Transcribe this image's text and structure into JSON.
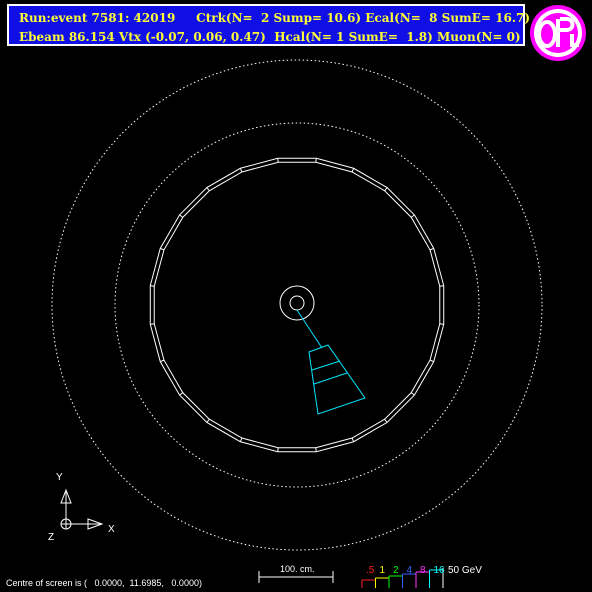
{
  "header": {
    "line1": "Run:event 7581: 42019     Ctrk(N=  2 Sump= 10.6) Ecal(N=  8 SumE= 16.7)",
    "line2": "Ebeam 86.154 Vtx (-0.07, 0.06, 0.47)  Hcal(N= 1 SumE=  1.8) Muon(N= 0)"
  },
  "logo": {
    "text": "OPAL",
    "bg_color": "#ff00ff",
    "fg_color": "#ffffff"
  },
  "axes": {
    "y": "Y",
    "x": "X",
    "z": "Z"
  },
  "scale": {
    "label": "100. cm."
  },
  "legend": {
    "values": [
      {
        "text": ".5",
        "color": "#ff2020"
      },
      {
        "text": "1",
        "color": "#ffff00"
      },
      {
        "text": "2",
        "color": "#00ff00"
      },
      {
        "text": "4",
        "color": "#3366ff"
      },
      {
        "text": "8",
        "color": "#ff33ff"
      },
      {
        "text": "16",
        "color": "#00ffff"
      }
    ],
    "unit": "50 GeV"
  },
  "status": {
    "text": "Centre of screen is (   0.0000,  11.6985,   0.0000)"
  },
  "colors": {
    "detector": "#ffffff",
    "track": "#00e5ff",
    "header_bg": "#1010e6",
    "header_text": "#ffff33"
  }
}
